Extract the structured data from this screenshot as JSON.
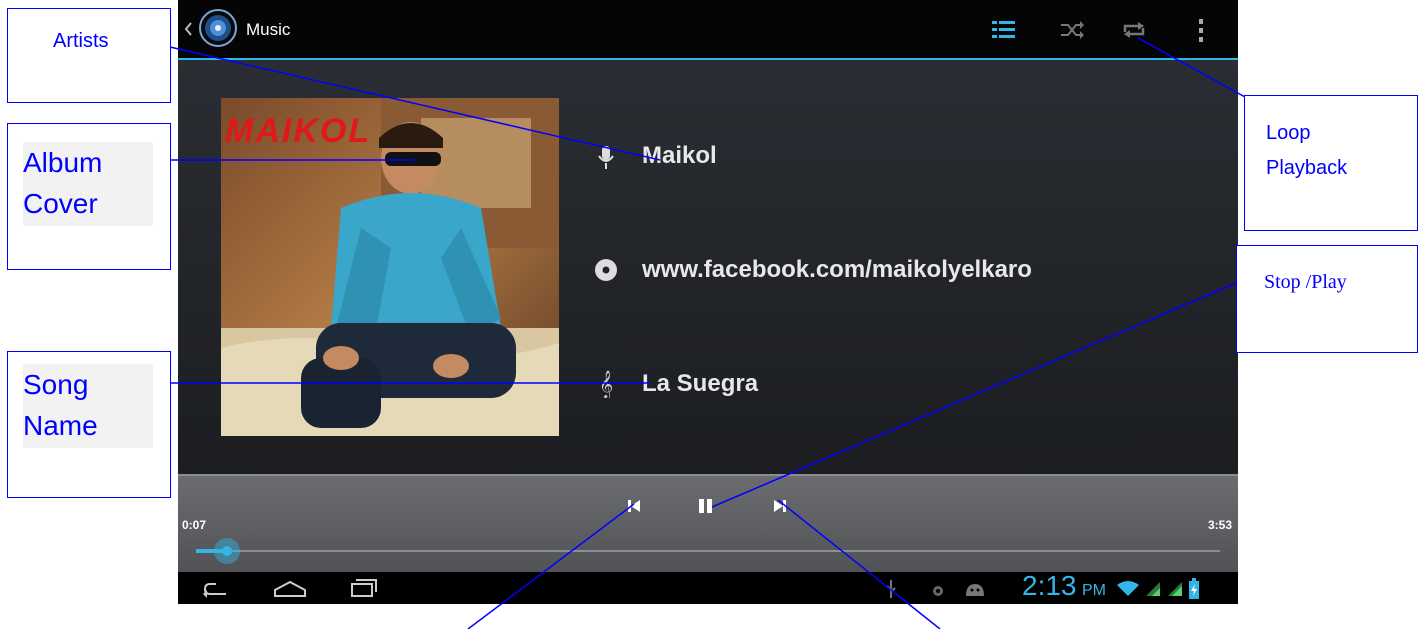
{
  "actionbar": {
    "title": "Music",
    "icons": [
      "back-chevron-icon",
      "music-app-icon",
      "playlist-icon",
      "shuffle-icon",
      "repeat-icon",
      "overflow-menu-icon"
    ]
  },
  "track": {
    "artist": "Maikol",
    "album": "www.facebook.com/maikolyelkaro",
    "song": "La Suegra",
    "cover_text": "MAIKOL"
  },
  "playback": {
    "elapsed": "0:07",
    "duration": "3:53",
    "progress": 0.03
  },
  "statusbar": {
    "time": "2:13",
    "ampm": "PM"
  },
  "annotations": {
    "artists": "Artists",
    "album_cover": "Album Cover",
    "album_cover_line1": "Album",
    "album_cover_line2": "Cover",
    "song_name_line1": "Song",
    "song_name_line2": "Name",
    "loop_line1": "Loop",
    "loop_line2": "Playback",
    "stop_play": "Stop /Play"
  },
  "colors": {
    "accent": "#33b5e5",
    "annotation": "#0000ff"
  }
}
